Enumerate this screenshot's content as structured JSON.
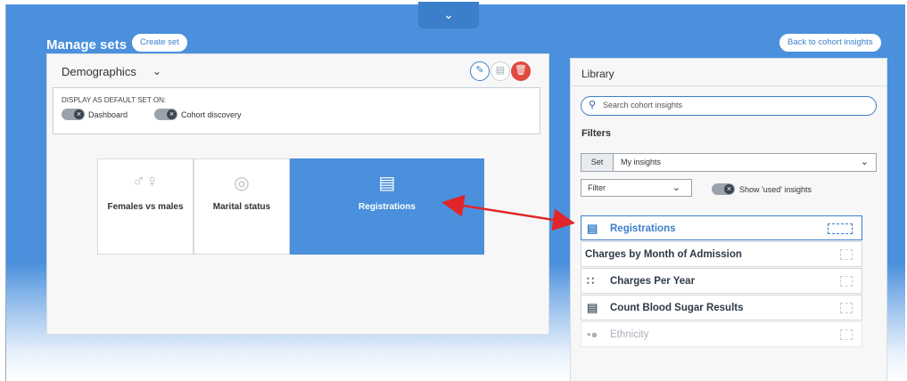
{
  "header": {
    "title": "Manage sets",
    "create_set": "Create set",
    "back": "Back to cohort insights",
    "top_tab_icon": "chevron-down"
  },
  "set_panel": {
    "set_name": "Demographics",
    "default_label": "DISPLAY AS DEFAULT SET ON:",
    "toggles": [
      "Dashboard",
      "Cohort discovery"
    ],
    "tiles": [
      {
        "label": "Females vs males",
        "icon": "people-icon"
      },
      {
        "label": "Marital status",
        "icon": "rings-icon"
      },
      {
        "label": "Registrations",
        "icon": "register-icon"
      }
    ]
  },
  "library": {
    "title": "Library",
    "search_placeholder": "Search cohort insights",
    "filters_label": "Filters",
    "set_tag": "Set",
    "set_value": "My insights",
    "filter_value": "Filter",
    "used_toggle_label": "Show 'used' insights",
    "items": [
      {
        "label": "Registrations",
        "icon": "register-icon",
        "state": "active"
      },
      {
        "label": "Charges by Month of Admission",
        "icon": "",
        "state": "normal"
      },
      {
        "label": "Charges Per Year",
        "icon": "dots-grid-icon",
        "state": "normal"
      },
      {
        "label": "Count Blood Sugar Results",
        "icon": "register-icon",
        "state": "normal"
      },
      {
        "label": "Ethnicity",
        "icon": "dots-icon",
        "state": "faded"
      }
    ]
  },
  "colors": {
    "brand_blue": "#4a90dc",
    "delete_red": "#e04a3f",
    "arrow_red": "#e0262a"
  }
}
